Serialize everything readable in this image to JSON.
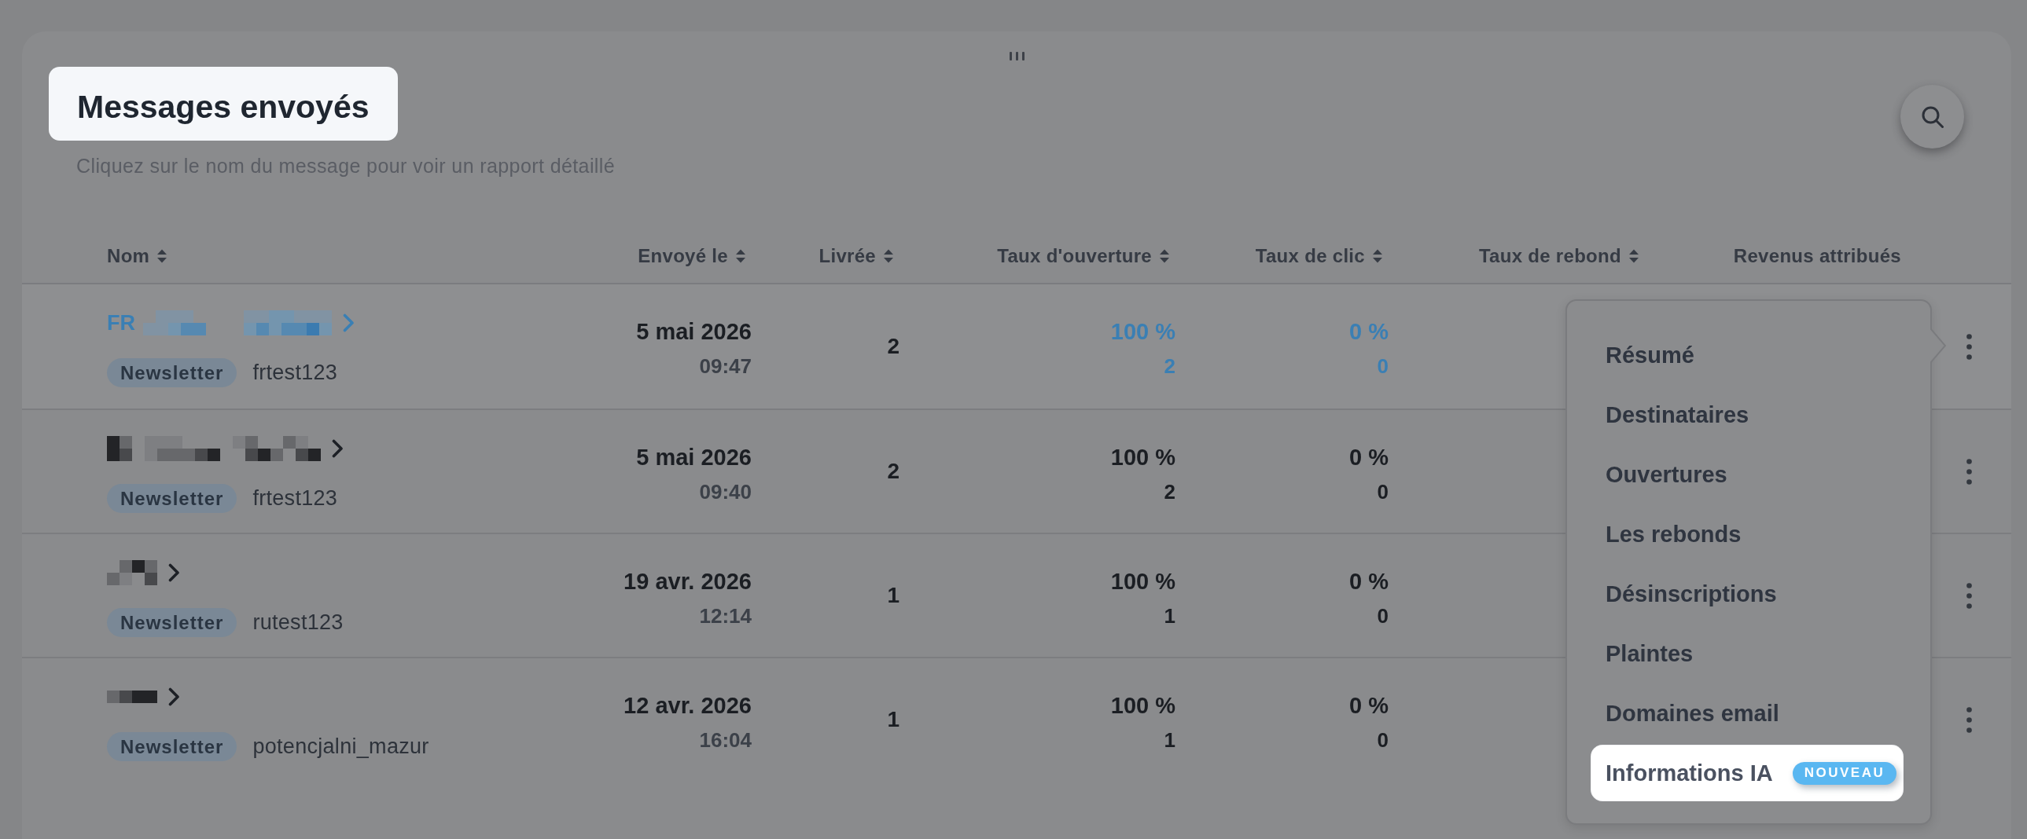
{
  "card": {
    "title": {
      "text": "Messages envoyés",
      "highlighted": true
    },
    "subtitle": "Cliquez sur le nom du message pour voir un rapport détaillé"
  },
  "table": {
    "columns": [
      {
        "label": "Nom",
        "sortable": true
      },
      {
        "label": "Envoyé le",
        "sortable": true
      },
      {
        "label": "Livrée",
        "sortable": true
      },
      {
        "label": "Taux d'ouverture",
        "sortable": true
      },
      {
        "label": "Taux de clic",
        "sortable": true
      },
      {
        "label": "Taux de rebond",
        "sortable": true
      },
      {
        "label": "Revenus attribués",
        "sortable": false
      }
    ],
    "rows": [
      {
        "hovered": true,
        "menu_open": true,
        "name": "FR",
        "type": "Newsletter",
        "list": "frtest123",
        "sent_date": "5 mai 2026",
        "sent_time": "09:47",
        "delivered": "2",
        "open_rate": "100 %",
        "opens": "2",
        "click_rate": "0 %",
        "clicks": "0"
      },
      {
        "hovered": false,
        "menu_open": false,
        "type": "Newsletter",
        "list": "frtest123",
        "sent_date": "5 mai 2026",
        "sent_time": "09:40",
        "delivered": "2",
        "open_rate": "100 %",
        "opens": "2",
        "click_rate": "0 %",
        "clicks": "0"
      },
      {
        "hovered": false,
        "menu_open": false,
        "type": "Newsletter",
        "list": "rutest123",
        "sent_date": "19 avr. 2026",
        "sent_time": "12:14",
        "delivered": "1",
        "open_rate": "100 %",
        "opens": "1",
        "click_rate": "0 %",
        "clicks": "0"
      },
      {
        "hovered": false,
        "menu_open": false,
        "type": "Newsletter",
        "list": "potencjalni_mazur",
        "sent_date": "12 avr. 2026",
        "sent_time": "16:04",
        "delivered": "1",
        "open_rate": "100 %",
        "opens": "1",
        "click_rate": "0 %",
        "clicks": "0"
      }
    ]
  },
  "row_menu": {
    "items": [
      {
        "label": "Résumé",
        "highlighted": false
      },
      {
        "label": "Destinataires",
        "highlighted": false
      },
      {
        "label": "Ouvertures",
        "highlighted": false
      },
      {
        "label": "Les rebonds",
        "highlighted": false
      },
      {
        "label": "Désinscriptions",
        "highlighted": false
      },
      {
        "label": "Plaintes",
        "highlighted": false
      },
      {
        "label": "Domaines email",
        "highlighted": false
      },
      {
        "label": "Informations IA",
        "highlighted": true,
        "badge": "NOUVEAU"
      }
    ]
  }
}
